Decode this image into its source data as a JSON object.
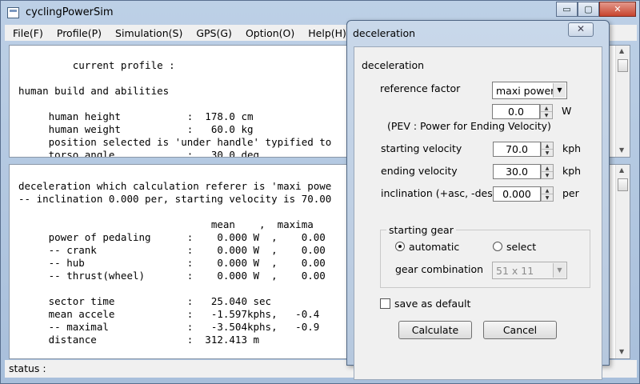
{
  "window": {
    "title": "cyclingPowerSim",
    "min_label": "▭",
    "max_label": "▢",
    "close_label": "✕"
  },
  "menu": [
    "File(F)",
    "Profile(P)",
    "Simulation(S)",
    "GPS(G)",
    "Option(O)",
    "Help(H)"
  ],
  "top_pane": {
    "lines": [
      "         current profile :",
      "",
      "human build and abilities",
      "",
      "     human height           :  178.0 cm",
      "     human weight           :   60.0 kg",
      "     position selected is 'under handle' typified to",
      "     torso angle            :   30.0 deg"
    ]
  },
  "bottom_pane": {
    "lines": [
      "deceleration which calculation referer is 'maxi powe",
      "-- inclination 0.000 per, starting velocity is 70.00",
      "",
      "                                mean    ,  maxima",
      "     power of pedaling      :    0.000 W  ,    0.00",
      "     -- crank               :    0.000 W  ,    0.00",
      "     -- hub                 :    0.000 W  ,    0.00",
      "     -- thrust(wheel)       :    0.000 W  ,    0.00",
      "",
      "     sector time            :   25.040 sec",
      "     mean accele            :   -1.597kphs,   -0.4",
      "     -- maximal             :   -3.504kphs,   -0.9",
      "     distance               :  312.413 m"
    ]
  },
  "status": {
    "label": "status :"
  },
  "dialog": {
    "title": "deceleration",
    "close_label": "✕",
    "section_label": "deceleration",
    "reference_factor": {
      "label": "reference factor",
      "value": "maxi power"
    },
    "pev": {
      "value": "0.0",
      "unit": "W",
      "note": "(PEV : Power for Ending Velocity)"
    },
    "starting_velocity": {
      "label": "starting velocity",
      "value": "70.0",
      "unit": "kph"
    },
    "ending_velocity": {
      "label": "ending velocity",
      "value": "30.0",
      "unit": "kph"
    },
    "inclination": {
      "label": "inclination (+asc, -des)",
      "value": "0.000",
      "unit": "per"
    },
    "starting_gear": {
      "group_label": "starting gear",
      "automatic_label": "automatic",
      "select_label": "select",
      "selected": "automatic",
      "gear_label": "gear combination",
      "gear_value": "51 x 11"
    },
    "save_default": {
      "label": "save as default",
      "checked": false
    },
    "calculate_label": "Calculate",
    "cancel_label": "Cancel"
  }
}
